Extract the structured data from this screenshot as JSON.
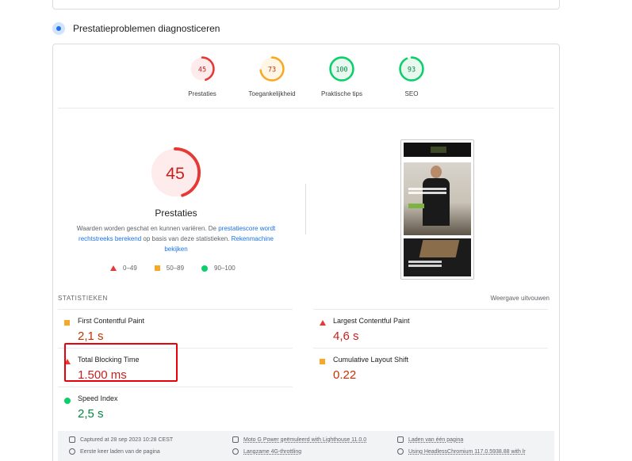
{
  "section": {
    "title": "Prestatieproblemen diagnosticeren"
  },
  "gauges": [
    {
      "score": "45",
      "label": "Prestaties",
      "color": "#e53935",
      "fill": 0.45,
      "bg": "#fdeceb"
    },
    {
      "score": "73",
      "label": "Toegankelijkheid",
      "color": "#f9a825",
      "fill": 0.73,
      "bg": "#fff6e6"
    },
    {
      "score": "100",
      "label": "Praktische tips",
      "color": "#0cce6b",
      "fill": 1.0,
      "bg": "#e8f8ef"
    },
    {
      "score": "93",
      "label": "SEO",
      "color": "#0cce6b",
      "fill": 0.93,
      "bg": "#e8f8ef"
    }
  ],
  "performance": {
    "score": "45",
    "fill": 0.45,
    "label": "Prestaties",
    "desc_pre": "Waarden worden geschat en kunnen variëren. De ",
    "desc_link1": "prestatiescore wordt rechtstreeks berekend",
    "desc_mid": " op basis van deze statistieken. ",
    "desc_link2": "Rekenmachine bekijken"
  },
  "legend": [
    {
      "label": "0–49",
      "icon": "red-triangle-icon"
    },
    {
      "label": "50–89",
      "icon": "orange-square-icon"
    },
    {
      "label": "90–100",
      "icon": "green-circle-icon"
    }
  ],
  "stats": {
    "heading": "STATISTIEKEN",
    "toggle": "Weergave uitvouwen",
    "metrics": [
      {
        "name": "First Contentful Paint",
        "value": "2,1 s",
        "rating": "average"
      },
      {
        "name": "Largest Contentful Paint",
        "value": "4,6 s",
        "rating": "fail"
      },
      {
        "name": "Total Blocking Time",
        "value": "1.500 ms",
        "rating": "fail"
      },
      {
        "name": "Cumulative Layout Shift",
        "value": "0.22",
        "rating": "average"
      },
      {
        "name": "Speed Index",
        "value": "2,5 s",
        "rating": "pass"
      }
    ]
  },
  "footer": {
    "captured": "Captured at 28 sep 2023 10:28 CEST",
    "device": "Moto G Power geëmuleerd with Lighthouse 11.0.0",
    "single": "Laden van één pagina",
    "first_load": "Eerste keer laden van de pagina",
    "throttling": "Langzame 4G-throttling",
    "browser": "Using HeadlessChromium 117.0.5938.88 with lr"
  },
  "colors": {
    "fail": "#e53935",
    "average": "#f9a825",
    "pass": "#0cce6b",
    "highlight": "#e8000b"
  }
}
